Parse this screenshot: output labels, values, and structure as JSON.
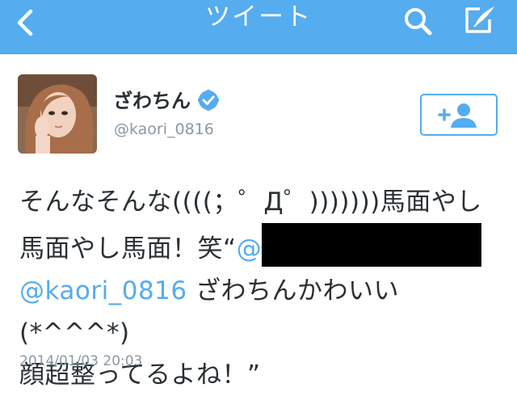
{
  "header": {
    "title": "ツイート",
    "back_icon": "chevron-left-icon",
    "search_icon": "search-icon",
    "compose_icon": "compose-tweet-icon",
    "bar_color": "#55acee"
  },
  "user": {
    "name": "ざわちん",
    "handle": "@kaori_0816",
    "verified": true,
    "verified_icon": "verified-badge-icon",
    "follow_icon": "follow-user-icon"
  },
  "tweet": {
    "line1": "そんなそんな((((；゜Д゜)))))))馬面やし",
    "line2_text": "馬面やし馬面！笑“",
    "line2_mention_prefix": "@",
    "line3_mention": "@kaori_0816",
    "line3_text": " ざわちんかわいい(*^^^*)",
    "line4": "顔超整ってるよね！”",
    "timestamp": "2014/01/03 20:03",
    "link_color": "#55acee"
  }
}
